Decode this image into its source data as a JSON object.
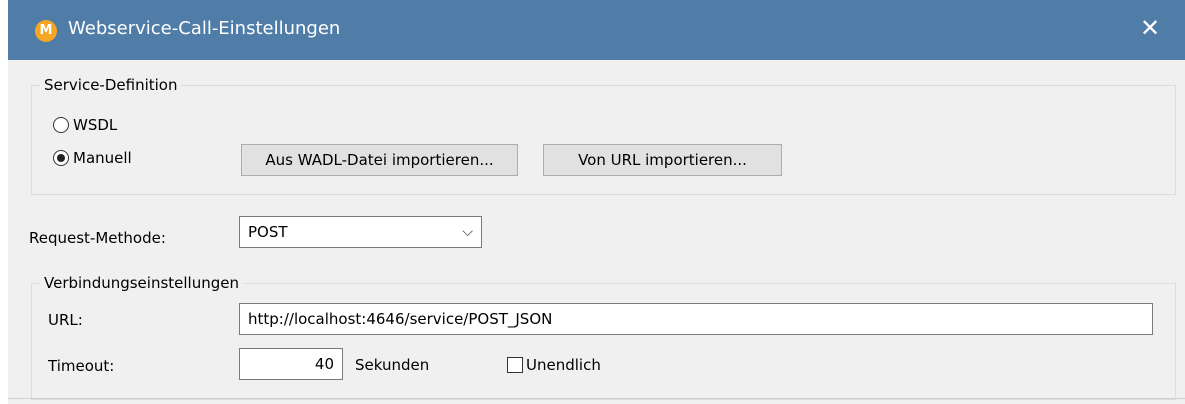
{
  "window": {
    "title": "Webservice-Call-Einstellungen",
    "icon": "altova-app-icon",
    "close_glyph": "✕"
  },
  "service_definition": {
    "label": "Service-Definition",
    "options": [
      {
        "label": "WSDL",
        "checked": false
      },
      {
        "label": "Manuell",
        "checked": true
      }
    ],
    "import_wadl_label": "Aus WADL-Datei importieren...",
    "import_url_label": "Von URL importieren..."
  },
  "request_method": {
    "label": "Request-Methode:",
    "value": "POST",
    "chevron_icon": "chevron-down-icon"
  },
  "connection_settings": {
    "label": "Verbindungseinstellungen",
    "url_label": "URL:",
    "url_value": "http://localhost:4646/service/POST_JSON",
    "timeout_label": "Timeout:",
    "timeout_value": "40",
    "timeout_unit": "Sekunden",
    "unlimited_label": "Unendlich",
    "unlimited_checked": false
  }
}
